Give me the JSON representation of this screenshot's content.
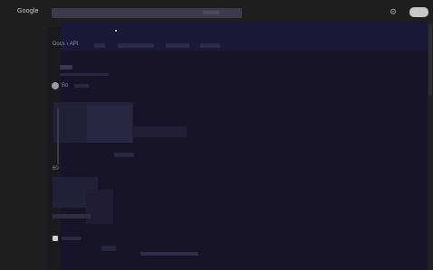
{
  "header": {
    "logo_text": "Google",
    "search_text": "",
    "settings_icon": "gear-icon"
  },
  "breadcrumb": {
    "text": "Docs › API"
  },
  "tabs": [
    "",
    "",
    "",
    ""
  ],
  "sections": {
    "label_1": "...",
    "label_2": "Bo",
    "label_3": "1",
    "label_4": "60",
    "label_5": "..."
  },
  "colors": {
    "background": "#202020",
    "content_bg": "#17142a",
    "search_bg": "#3c3a4b"
  }
}
